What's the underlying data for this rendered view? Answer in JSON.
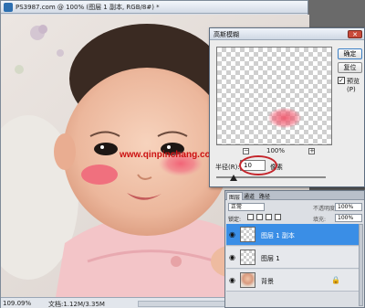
{
  "document": {
    "title": "PS3987.com @ 100% (图层 1 副本, RGB/8#) *",
    "watermark": "www.qinpinchang.com",
    "status_zoom": "109.09%",
    "status_doc": "文档:1.12M/3.35M"
  },
  "blur_dialog": {
    "title": "高斯模糊",
    "close_glyph": "✕",
    "ok_label": "确定",
    "reset_label": "复位",
    "preview_label": "预览(P)",
    "preview_checked": "✓",
    "zoom_out_glyph": "−",
    "zoom_in_glyph": "+",
    "zoom_level": "100%",
    "radius_label": "半径(R):",
    "radius_value": "10",
    "radius_unit": "像素"
  },
  "layers_panel": {
    "tabs": [
      "图层",
      "通道",
      "路径"
    ],
    "blend_mode": "正常",
    "opacity_label": "不透明度:",
    "opacity_value": "100%",
    "lock_label": "锁定:",
    "fill_label": "填充:",
    "fill_value": "100%",
    "eye_glyph": "◉",
    "lock_glyph": "🔒",
    "layers": [
      {
        "name": "图层 1 副本",
        "selected": true
      },
      {
        "name": "图层 1",
        "selected": false
      },
      {
        "name": "背景",
        "selected": false
      }
    ]
  },
  "colors": {
    "selection_blue": "#3a8ee6",
    "annotation_red": "#c4242a",
    "blush_pink": "#f0707e",
    "watermark_red": "#cc1111"
  }
}
